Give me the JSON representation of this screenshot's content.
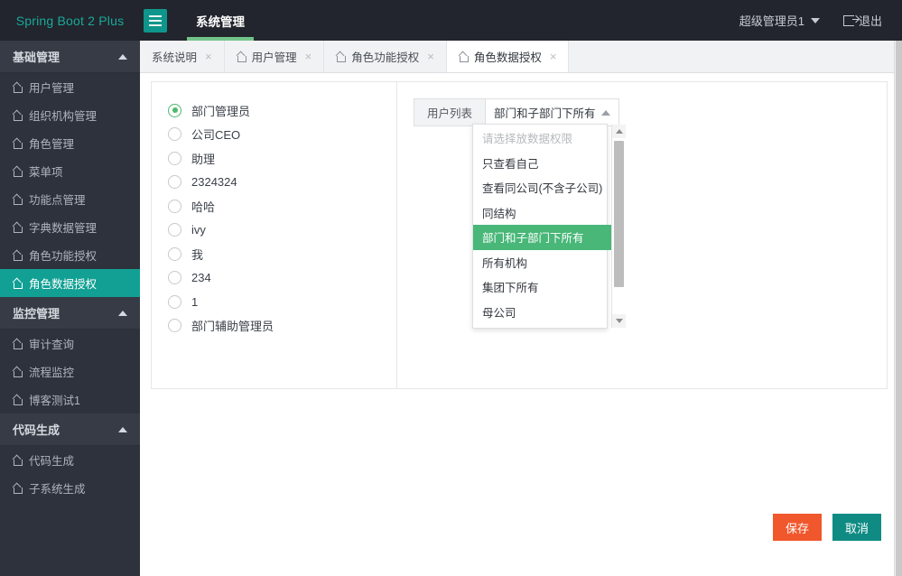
{
  "header": {
    "brand": "Spring Boot 2 Plus",
    "menu_icon": "hamburger-icon",
    "nav_tabs": [
      {
        "label": "系统管理",
        "active": true
      }
    ],
    "user_name": "超级管理员1",
    "logout_label": "退出"
  },
  "sidebar": {
    "groups": [
      {
        "title": "基础管理",
        "items": [
          {
            "label": "用户管理",
            "active": false
          },
          {
            "label": "组织机构管理",
            "active": false
          },
          {
            "label": "角色管理",
            "active": false
          },
          {
            "label": "菜单项",
            "active": false
          },
          {
            "label": "功能点管理",
            "active": false
          },
          {
            "label": "字典数据管理",
            "active": false
          },
          {
            "label": "角色功能授权",
            "active": false
          },
          {
            "label": "角色数据授权",
            "active": true
          }
        ]
      },
      {
        "title": "监控管理",
        "items": [
          {
            "label": "审计查询",
            "active": false
          },
          {
            "label": "流程监控",
            "active": false
          },
          {
            "label": "博客测试1",
            "active": false
          }
        ]
      },
      {
        "title": "代码生成",
        "items": [
          {
            "label": "代码生成",
            "active": false
          },
          {
            "label": "子系统生成",
            "active": false
          }
        ]
      }
    ]
  },
  "tabstrip": {
    "tabs": [
      {
        "label": "系统说明",
        "icon": false,
        "active": false,
        "close": "×"
      },
      {
        "label": "用户管理",
        "icon": true,
        "active": false,
        "close": "×"
      },
      {
        "label": "角色功能授权",
        "icon": true,
        "active": false,
        "close": "×"
      },
      {
        "label": "角色数据授权",
        "icon": true,
        "active": true,
        "close": "×"
      }
    ]
  },
  "main": {
    "roles": [
      {
        "label": "部门管理员",
        "selected": true
      },
      {
        "label": "公司CEO",
        "selected": false
      },
      {
        "label": "助理",
        "selected": false
      },
      {
        "label": "2324324",
        "selected": false
      },
      {
        "label": "哈哈",
        "selected": false
      },
      {
        "label": "ivy",
        "selected": false
      },
      {
        "label": "我",
        "selected": false
      },
      {
        "label": "234",
        "selected": false
      },
      {
        "label": "1",
        "selected": false
      },
      {
        "label": "部门辅助管理员",
        "selected": false
      }
    ],
    "field": {
      "addon_label": "用户列表",
      "selected_value": "部门和子部门下所有",
      "caret": "chevron-up-icon"
    },
    "dropdown": {
      "open": true,
      "options": [
        {
          "label": "请选择放数据权限",
          "placeholder": true,
          "selected": false
        },
        {
          "label": "只查看自己",
          "placeholder": false,
          "selected": false
        },
        {
          "label": "查看同公司(不含子公司)",
          "placeholder": false,
          "selected": false
        },
        {
          "label": "同结构",
          "placeholder": false,
          "selected": false
        },
        {
          "label": "部门和子部门下所有",
          "placeholder": false,
          "selected": true
        },
        {
          "label": "所有机构",
          "placeholder": false,
          "selected": false
        },
        {
          "label": "集团下所有",
          "placeholder": false,
          "selected": false
        },
        {
          "label": "母公司",
          "placeholder": false,
          "selected": false
        }
      ]
    },
    "buttons": {
      "save": "保存",
      "cancel": "取消"
    }
  },
  "colors": {
    "brand_teal": "#19a99a",
    "active_sidebar": "#12a094",
    "save_orange": "#f1572c",
    "cancel_teal": "#0f8b84",
    "dropdown_selected_green": "#48b778",
    "radio_green": "#4cb96b",
    "header_dark": "#22252d"
  }
}
